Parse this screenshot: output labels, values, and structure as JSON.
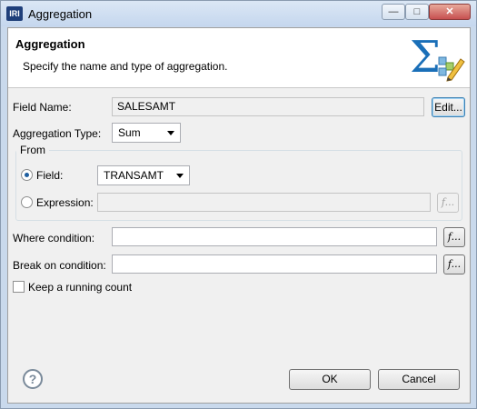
{
  "window": {
    "title": "Aggregation",
    "app_icon_text": "IRI"
  },
  "header": {
    "title": "Aggregation",
    "description": "Specify the name and type of aggregation.",
    "icon": "sigma-edit-icon"
  },
  "form": {
    "field_name_label": "Field Name:",
    "field_name_value": "SALESAMT",
    "edit_button": "Edit...",
    "aggregation_type_label": "Aggregation Type:",
    "aggregation_type_value": "Sum",
    "from_group_label": "From",
    "from_field_label": "Field:",
    "from_field_value": "TRANSAMT",
    "from_field_selected": true,
    "expression_label": "Expression:",
    "expression_value": "",
    "function_button": "f...",
    "where_label": "Where condition:",
    "where_value": "",
    "break_label": "Break on condition:",
    "break_value": "",
    "running_count_label": "Keep a running count",
    "running_count_checked": false
  },
  "footer": {
    "ok": "OK",
    "cancel": "Cancel",
    "help_icon": "?"
  }
}
